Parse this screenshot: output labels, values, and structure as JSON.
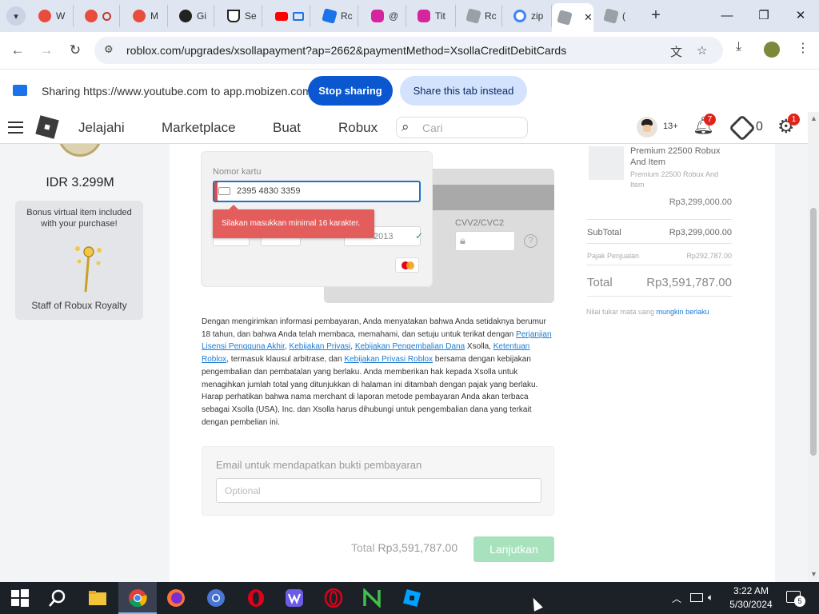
{
  "browser": {
    "tabs": [
      {
        "label": "W",
        "color": "#e74c3c"
      },
      {
        "label": "",
        "color": "#e74c3c"
      },
      {
        "label": "M",
        "color": "#e74c3c"
      },
      {
        "label": "Gi",
        "color": "#222222"
      },
      {
        "label": "Se",
        "color": "#222222"
      },
      {
        "label": "",
        "color": "#ff0000"
      },
      {
        "label": "Rc",
        "color": "#1a73e8"
      },
      {
        "label": "@",
        "color": "#d6249f"
      },
      {
        "label": "Tit",
        "color": "#d6249f"
      },
      {
        "label": "Rc",
        "color": "#9aa0a6"
      },
      {
        "label": "zip",
        "color": "#4285f4"
      },
      {
        "label": "",
        "color": "#9aa0a6"
      },
      {
        "label": "(",
        "color": "#9aa0a6"
      }
    ],
    "url": "roblox.com/upgrades/xsollapayment?ap=2662&paymentMethod=XsollaCreditDebitCards",
    "share_text": "Sharing https://www.youtube.com to app.mobizen.com",
    "stop_sharing": "Stop sharing",
    "share_tab": "Share this tab instead"
  },
  "roblox_nav": {
    "links": [
      "Jelajahi",
      "Marketplace",
      "Buat",
      "Robux"
    ],
    "search_placeholder": "Cari",
    "age": "13+",
    "notifications": "7",
    "robux": "0",
    "settings_badge": "1"
  },
  "left": {
    "price": "IDR 3.299M",
    "bonus_text": "Bonus virtual item included with your purchase!",
    "bonus_name": "Staff of Robux Royalty"
  },
  "payment": {
    "card_label": "Nomor kartu",
    "card_value": "2395 4830 3359",
    "error": "Silakan masukkan minimal 16 karakter.",
    "expiry_value": "2013",
    "cvv_label": "CVV2/CVC2",
    "legal": {
      "p1": "Dengan mengirimkan informasi pembayaran, Anda menyatakan bahwa Anda setidaknya berumur 18 tahun, dan bahwa Anda telah membaca, memahami, dan setuju untuk terikat dengan ",
      "link1": "Perjanjian Lisensi Pengguna Akhir",
      "sep1": ", ",
      "link2": "Kebijakan Privasi",
      "sep2": ", ",
      "link3": "Kebijakan Pengembalian Dana",
      "p2": " Xsolla, ",
      "link4": "Ketentuan Roblox",
      "p3": ", termasuk klausul arbitrase, dan ",
      "link5": "Kebijakan Privasi Roblox",
      "p4": " bersama dengan kebijakan pengembalian dan pembatalan yang berlaku. Anda memberikan hak kepada Xsolla untuk menagihkan jumlah total yang ditunjukkan di halaman ini ditambah dengan pajak yang berlaku. Harap perhatikan bahwa nama merchant di laporan metode pembayaran Anda akan terbaca sebagai Xsolla (USA), Inc. dan Xsolla harus dihubungi untuk pengembalian dana yang terkait dengan pembelian ini."
    },
    "email_label": "Email untuk mendapatkan bukti pembayaran",
    "email_placeholder": "Optional",
    "total_label": "Total",
    "total_amount": "Rp3,591,787.00",
    "continue": "Lanjutkan"
  },
  "summary": {
    "product_name": "Premium 22500 Robux And Item",
    "product_sub": "Premium 22500 Robux And Item",
    "product_price": "Rp3,299,000.00",
    "subtotal_label": "SubTotal",
    "subtotal": "Rp3,299,000.00",
    "tax_label": "Pajak Penjualan",
    "tax": "Rp292,787.00",
    "total_label": "Total",
    "total": "Rp3,591,787.00",
    "rate_note": "Nilai tukar mata uang ",
    "rate_link": "mungkin berlaku"
  },
  "taskbar": {
    "time": "3:22 AM",
    "date": "5/30/2024",
    "notif_count": "5"
  }
}
